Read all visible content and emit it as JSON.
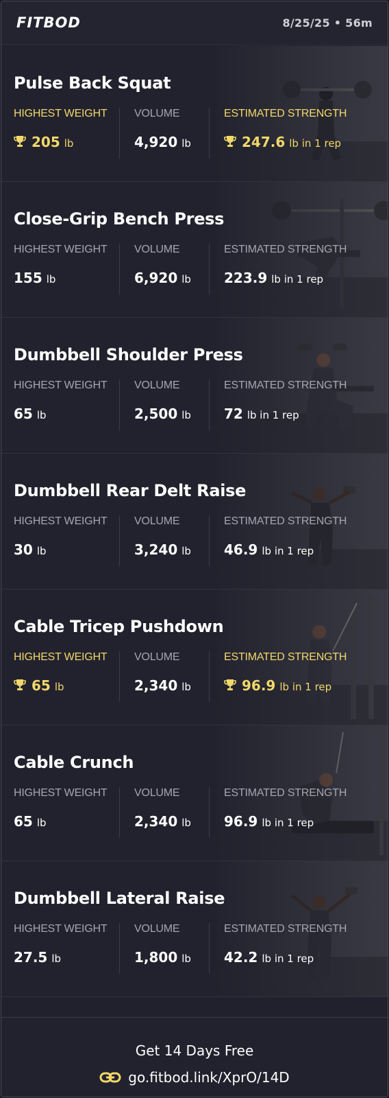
{
  "header": {
    "logo_text": "FITBOD",
    "session_info": "8/25/25 • 56m"
  },
  "labels": {
    "highest_weight": "HIGHEST WEIGHT",
    "volume": "VOLUME",
    "estimated_strength": "ESTIMATED STRENGTH"
  },
  "colors": {
    "gold": "#f2d86a",
    "background": "#22222e",
    "label_gray": "#a6a6b2"
  },
  "exercises": [
    {
      "name": "Pulse Back Squat",
      "record": true,
      "highest_weight": "205",
      "highest_weight_unit": "lb",
      "volume": "4,920",
      "volume_unit": "lb",
      "estimated_strength": "247.6",
      "estimated_strength_unit": "lb in 1 rep",
      "icon": "trophy-icon"
    },
    {
      "name": "Close-Grip Bench Press",
      "record": false,
      "highest_weight": "155",
      "highest_weight_unit": "lb",
      "volume": "6,920",
      "volume_unit": "lb",
      "estimated_strength": "223.9",
      "estimated_strength_unit": "lb in 1 rep"
    },
    {
      "name": "Dumbbell Shoulder Press",
      "record": false,
      "highest_weight": "65",
      "highest_weight_unit": "lb",
      "volume": "2,500",
      "volume_unit": "lb",
      "estimated_strength": "72",
      "estimated_strength_unit": "lb in 1 rep"
    },
    {
      "name": "Dumbbell Rear Delt Raise",
      "record": false,
      "highest_weight": "30",
      "highest_weight_unit": "lb",
      "volume": "3,240",
      "volume_unit": "lb",
      "estimated_strength": "46.9",
      "estimated_strength_unit": "lb in 1 rep"
    },
    {
      "name": "Cable Tricep Pushdown",
      "record": true,
      "highest_weight": "65",
      "highest_weight_unit": "lb",
      "volume": "2,340",
      "volume_unit": "lb",
      "estimated_strength": "96.9",
      "estimated_strength_unit": "lb in 1 rep",
      "icon": "trophy-icon"
    },
    {
      "name": "Cable Crunch",
      "record": false,
      "highest_weight": "65",
      "highest_weight_unit": "lb",
      "volume": "2,340",
      "volume_unit": "lb",
      "estimated_strength": "96.9",
      "estimated_strength_unit": "lb in 1 rep"
    },
    {
      "name": "Dumbbell Lateral Raise",
      "record": false,
      "highest_weight": "27.5",
      "highest_weight_unit": "lb",
      "volume": "1,800",
      "volume_unit": "lb",
      "estimated_strength": "42.2",
      "estimated_strength_unit": "lb in 1 rep"
    }
  ],
  "footer": {
    "cta_text": "Get 14 Days Free",
    "link_text": "go.fitbod.link/XprO/14D",
    "link_icon": "link-icon"
  }
}
